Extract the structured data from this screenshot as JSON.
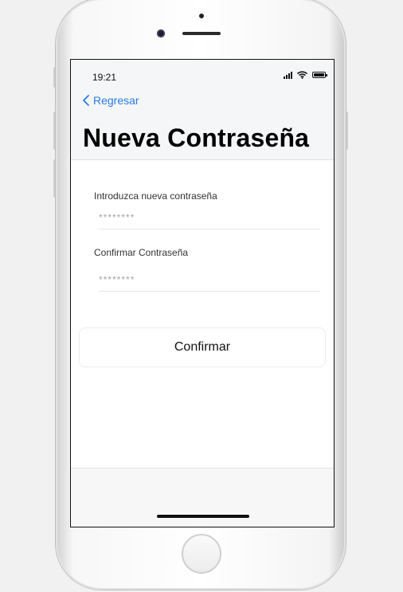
{
  "status_bar": {
    "time": "19:21",
    "icons": [
      "signal-icon",
      "wifi-icon",
      "battery-icon"
    ]
  },
  "nav": {
    "back_label": "Regresar",
    "back_icon": "chevron-left-icon"
  },
  "header": {
    "title": "Nueva Contraseña"
  },
  "form": {
    "new_password": {
      "label": "Introduzca nueva contraseña",
      "placeholder": "********",
      "value": ""
    },
    "confirm_password": {
      "label": "Confirmar Contraseña",
      "placeholder": "********",
      "value": ""
    },
    "submit_label": "Confirmar"
  },
  "colors": {
    "accent": "#2b7be0",
    "header_bg": "#f5f6f8",
    "text": "#111111"
  }
}
